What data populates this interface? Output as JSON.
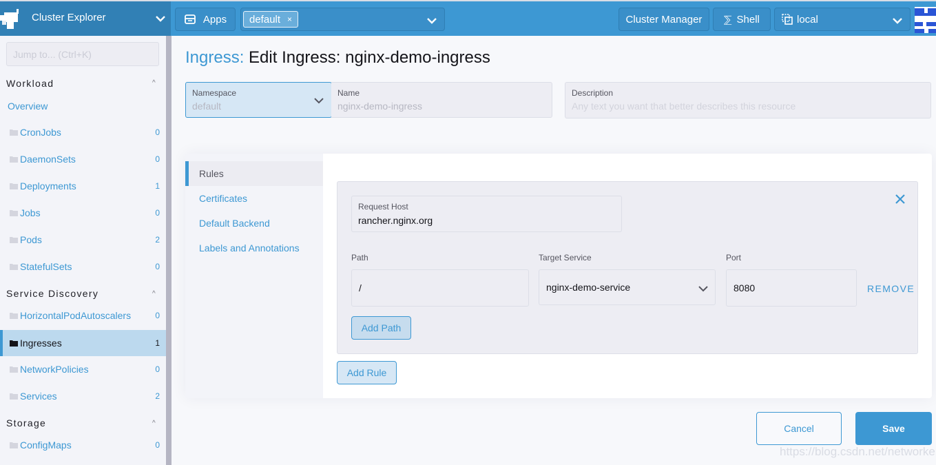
{
  "header": {
    "product": "Cluster Explorer",
    "apps_label": "Apps",
    "namespace_chip": "default",
    "chip_remove": "×",
    "cluster_manager_label": "Cluster Manager",
    "shell_label": "Shell",
    "shell_glyph": "⅀",
    "cluster_name": "local"
  },
  "sidebar": {
    "jump_placeholder": "Jump to... (Ctrl+K)",
    "groups": [
      {
        "title": "Workload",
        "caret": "^"
      },
      {
        "title": "Service Discovery",
        "caret": "^"
      },
      {
        "title": "Storage",
        "caret": "^"
      }
    ],
    "overview_label": "Overview",
    "items": [
      {
        "label": "CronJobs",
        "count": "0"
      },
      {
        "label": "DaemonSets",
        "count": "0"
      },
      {
        "label": "Deployments",
        "count": "1"
      },
      {
        "label": "Jobs",
        "count": "0"
      },
      {
        "label": "Pods",
        "count": "2"
      },
      {
        "label": "StatefulSets",
        "count": "0"
      },
      {
        "label": "HorizontalPodAutoscalers",
        "count": "0"
      },
      {
        "label": "Ingresses",
        "count": "1",
        "active": true
      },
      {
        "label": "NetworkPolicies",
        "count": "0"
      },
      {
        "label": "Services",
        "count": "2"
      },
      {
        "label": "ConfigMaps",
        "count": "0"
      }
    ]
  },
  "page": {
    "crumb": "Ingress:",
    "title": "Edit Ingress: nginx-demo-ingress"
  },
  "form": {
    "namespace": {
      "label": "Namespace",
      "value": "default"
    },
    "name": {
      "label": "Name",
      "value": "nginx-demo-ingress"
    },
    "description": {
      "label": "Description",
      "placeholder": "Any text you want that better describes this resource"
    }
  },
  "tabs": [
    {
      "label": "Rules",
      "active": true
    },
    {
      "label": "Certificates"
    },
    {
      "label": "Default Backend"
    },
    {
      "label": "Labels and Annotations"
    }
  ],
  "rule": {
    "host_label": "Request Host",
    "host_value": "rancher.nginx.org",
    "path_label": "Path",
    "path_value": "/",
    "service_label": "Target Service",
    "service_value": "nginx-demo-service",
    "port_label": "Port",
    "port_value": "8080",
    "remove_label": "REMOVE",
    "add_path_label": "Add Path"
  },
  "add_rule_label": "Add Rule",
  "footer": {
    "cancel_label": "Cancel",
    "save_label": "Save"
  },
  "watermark": "https://blog.csdn.net/networken",
  "colors": {
    "accent": "#3d98d3",
    "header_bg": "#3d98d3",
    "brand_bg": "#3180b5",
    "active_nav": "#bcd9ee"
  }
}
